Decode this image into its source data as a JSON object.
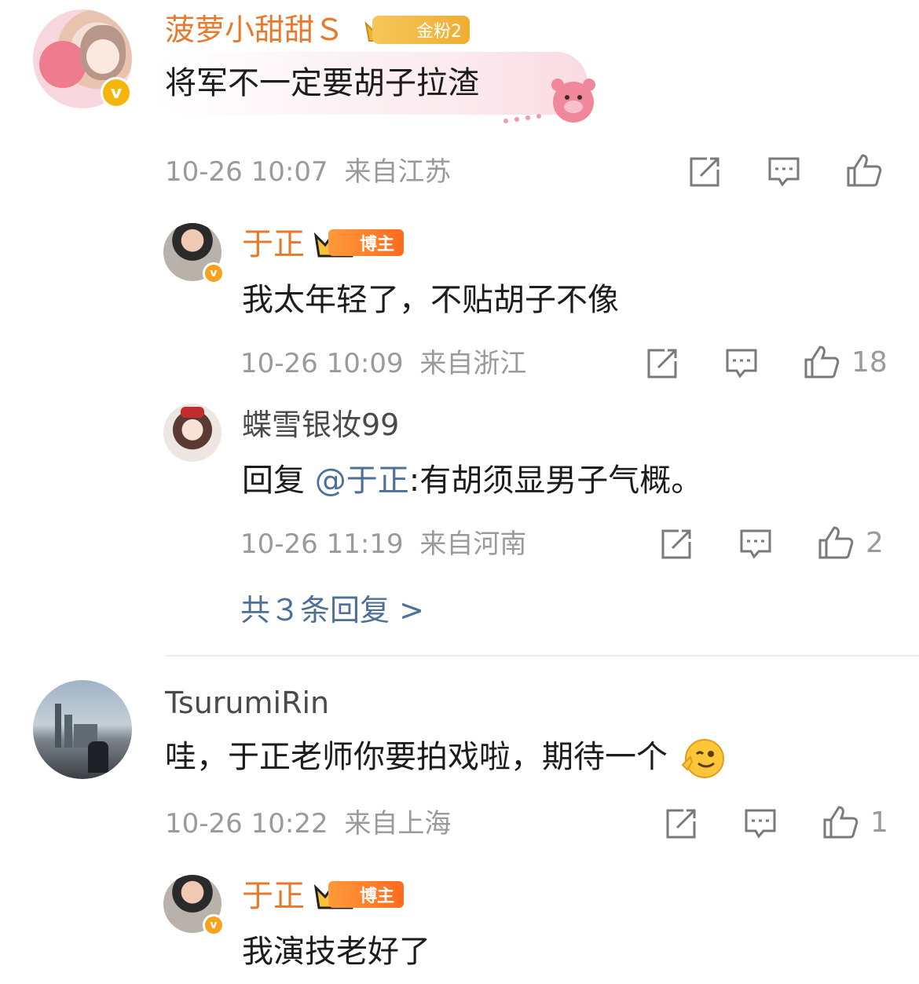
{
  "comments": [
    {
      "user": "菠萝小甜甜Ｓ",
      "badge": "金粉2",
      "text": "将军不一定要胡子拉渣",
      "time": "10-26 10:07",
      "location": "来自江苏",
      "likes": ""
    },
    {
      "user": "于正",
      "badge": "博主",
      "text": "我太年轻了，不贴胡子不像",
      "time": "10-26 10:09",
      "location": "来自浙江",
      "likes": "18"
    },
    {
      "user": "蝶雪银妆99",
      "reply_prefix": "回复 ",
      "mention": "@于正",
      "text": ":有胡须显男子气概。",
      "time": "10-26 11:19",
      "location": "来自河南",
      "likes": "2"
    },
    {
      "more_replies": "共３条回复 >"
    },
    {
      "user": "TsurumiRin",
      "text": "哇，于正老师你要拍戏啦，期待一个",
      "time": "10-26 10:22",
      "location": "来自上海",
      "likes": "1"
    },
    {
      "user": "于正",
      "badge": "博主",
      "text": "我演技老好了"
    }
  ],
  "colors": {
    "name_highlight": "#e8792c",
    "link": "#4e6f98",
    "meta": "#9a9a9a"
  },
  "icons": [
    "share-icon",
    "comment-icon",
    "like-icon",
    "verified-icon",
    "crown-icon",
    "emoji-wink-icon",
    "bear-sticker-icon"
  ]
}
